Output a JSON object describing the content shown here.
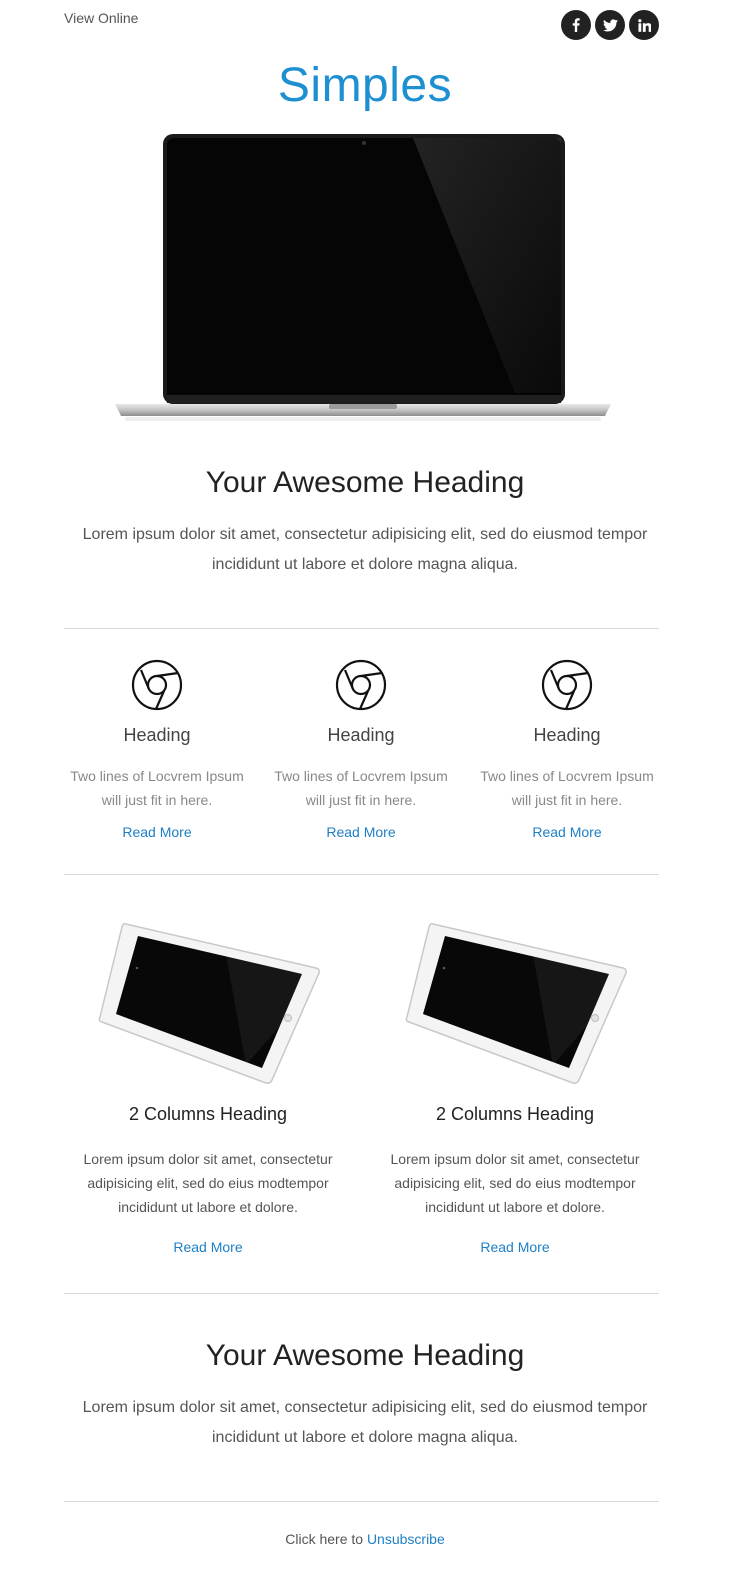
{
  "header": {
    "view_online": "View Online",
    "social": [
      {
        "icon": "facebook-icon",
        "glyph": "f"
      },
      {
        "icon": "twitter-icon",
        "glyph": "t"
      },
      {
        "icon": "linkedin-icon",
        "glyph": "in"
      }
    ],
    "logo": "Simples"
  },
  "section1": {
    "heading": "Your Awesome Heading",
    "body": "Lorem ipsum dolor sit amet, consectetur adipisicing elit, sed do eiusmod tempor incididunt ut labore et dolore magna aliqua."
  },
  "features": [
    {
      "icon": "chrome-icon",
      "heading": "Heading",
      "text": "Two lines of Locvrem Ipsum will just fit in here.",
      "link": "Read More"
    },
    {
      "icon": "chrome-icon",
      "heading": "Heading",
      "text": "Two lines of Locvrem Ipsum will just fit in here.",
      "link": "Read More"
    },
    {
      "icon": "chrome-icon",
      "heading": "Heading",
      "text": "Two lines of Locvrem Ipsum will just fit in here.",
      "link": "Read More"
    }
  ],
  "columns": [
    {
      "heading": "2 Columns Heading",
      "text": "Lorem ipsum dolor sit amet, consectetur adipisicing elit, sed do eius modtempor incididunt ut labore et dolore.",
      "link": "Read More"
    },
    {
      "heading": "2 Columns Heading",
      "text": "Lorem ipsum dolor sit amet, consectetur adipisicing elit, sed do eius modtempor incididunt ut labore et dolore.",
      "link": "Read More"
    }
  ],
  "section2": {
    "heading": "Your Awesome Heading",
    "body": "Lorem ipsum dolor sit amet, consectetur adipisicing elit, sed do eiusmod tempor incididunt ut labore et dolore magna aliqua."
  },
  "footer": {
    "prefix": "Click here to",
    "unsubscribe": "Unsubscribe"
  },
  "colors": {
    "accent": "#1e90d2",
    "link": "#1e7fc6",
    "rule": "#d6d6d6"
  }
}
